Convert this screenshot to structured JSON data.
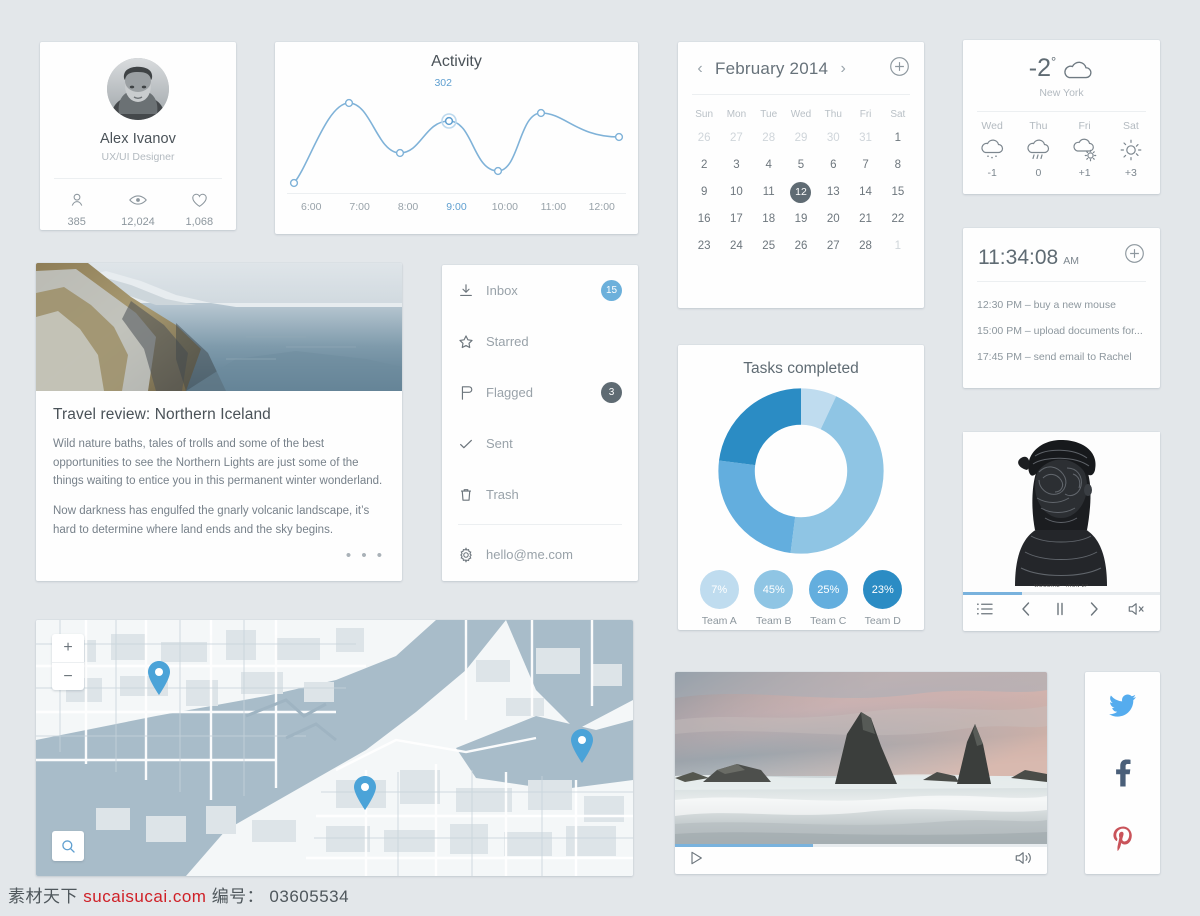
{
  "profile": {
    "name": "Alex Ivanov",
    "role": "UX/UI Designer",
    "stats": [
      {
        "icon": "person-icon",
        "value": "385"
      },
      {
        "icon": "eye-icon",
        "value": "12,024"
      },
      {
        "icon": "heart-icon",
        "value": "1,068"
      }
    ]
  },
  "activity": {
    "title": "Activity",
    "highlight_value": "302",
    "highlight_tick": "9:00"
  },
  "chart_data": [
    {
      "type": "line",
      "title": "Activity",
      "xlabel": "",
      "ylabel": "",
      "categories": [
        "6:00",
        "7:00",
        "8:00",
        "9:00",
        "10:00",
        "11:00",
        "12:00"
      ],
      "values": [
        20,
        330,
        175,
        302,
        110,
        320,
        205
      ],
      "highlight_index": 3,
      "highlight_label": "302",
      "grid": false,
      "legend": "none",
      "accent": "#6ba3d0"
    },
    {
      "type": "pie",
      "title": "Tasks completed",
      "categories": [
        "Team A",
        "Team B",
        "Team C",
        "Team D"
      ],
      "values": [
        7,
        45,
        25,
        23
      ],
      "labels": [
        "7%",
        "45%",
        "25%",
        "23%"
      ],
      "colors": [
        "#bfdcef",
        "#8fc5e4",
        "#63aede",
        "#2b8cc4"
      ],
      "donut": true,
      "legend": "bottom"
    }
  ],
  "calendar": {
    "month": "February 2014",
    "prev": "‹",
    "next": "›",
    "dow": [
      "Sun",
      "Mon",
      "Tue",
      "Wed",
      "Thu",
      "Fri",
      "Sat"
    ],
    "weeks": [
      [
        {
          "d": "26",
          "mute": true
        },
        {
          "d": "27",
          "mute": true
        },
        {
          "d": "28",
          "mute": true
        },
        {
          "d": "29",
          "mute": true
        },
        {
          "d": "30",
          "mute": true
        },
        {
          "d": "31",
          "mute": true
        },
        {
          "d": "1",
          "mute": false
        }
      ],
      [
        {
          "d": "2"
        },
        {
          "d": "3"
        },
        {
          "d": "4"
        },
        {
          "d": "5"
        },
        {
          "d": "6"
        },
        {
          "d": "7"
        },
        {
          "d": "8"
        }
      ],
      [
        {
          "d": "9"
        },
        {
          "d": "10"
        },
        {
          "d": "11"
        },
        {
          "d": "12",
          "sel": true
        },
        {
          "d": "13"
        },
        {
          "d": "14"
        },
        {
          "d": "15"
        }
      ],
      [
        {
          "d": "16"
        },
        {
          "d": "17"
        },
        {
          "d": "18"
        },
        {
          "d": "19"
        },
        {
          "d": "20"
        },
        {
          "d": "21"
        },
        {
          "d": "22"
        }
      ],
      [
        {
          "d": "23"
        },
        {
          "d": "24"
        },
        {
          "d": "25"
        },
        {
          "d": "26"
        },
        {
          "d": "27"
        },
        {
          "d": "28"
        },
        {
          "d": "1",
          "mute": true
        }
      ]
    ]
  },
  "weather": {
    "temp": "-2",
    "degree": "°",
    "now_icon": "cloud-icon",
    "city": "New York",
    "forecast": [
      {
        "day": "Wed",
        "icon": "snow-cloud-icon",
        "temp": "-1"
      },
      {
        "day": "Thu",
        "icon": "rain-cloud-icon",
        "temp": "0"
      },
      {
        "day": "Fri",
        "icon": "sun-cloud-icon",
        "temp": "+1"
      },
      {
        "day": "Sat",
        "icon": "sun-icon",
        "temp": "+3"
      }
    ]
  },
  "clock": {
    "time": "11:34:08",
    "ampm": "AM",
    "events": [
      "12:30 PM – buy a new mouse",
      "15:00  PM – upload documents for...",
      "17:45  PM – send email to Rachel"
    ]
  },
  "travel": {
    "title": "Travel review: Northern Iceland",
    "paragraph1": "Wild nature baths, tales of trolls and some of the best opportunities to see the Northern Lights are just some of the things waiting to entice you in this permanent winter wonderland.",
    "paragraph2": "Now darkness has engulfed the gnarly volcanic landscape, it’s hard to determine where land ends and the sky begins.",
    "more": "• • •"
  },
  "mail": {
    "items": [
      {
        "label": "Inbox",
        "icon": "inbox-icon",
        "badge": "15",
        "badge_color": "#6cb0db"
      },
      {
        "label": "Starred",
        "icon": "star-icon",
        "badge": "",
        "badge_color": ""
      },
      {
        "label": "Flagged",
        "icon": "flag-icon",
        "badge": "3",
        "badge_color": "#5f6b73"
      },
      {
        "label": "Sent",
        "icon": "check-icon",
        "badge": "",
        "badge_color": ""
      },
      {
        "label": "Trash",
        "icon": "trash-icon",
        "badge": "",
        "badge_color": ""
      }
    ],
    "account": {
      "label": "hello@me.com",
      "icon": "gear-icon"
    }
  },
  "music": {
    "caption": "WOODKID - IRON EP",
    "progress_pct": 30,
    "controls": [
      {
        "name": "playlist-icon"
      },
      {
        "name": "previous-icon"
      },
      {
        "name": "pause-icon"
      },
      {
        "name": "next-icon"
      },
      {
        "name": "volume-mute-icon"
      }
    ]
  },
  "video": {
    "progress_pct": 37,
    "play_icon": "play-icon",
    "volume_icon": "volume-icon"
  },
  "map": {
    "zoom_in": "+",
    "zoom_out": "−",
    "search_icon": "search-icon",
    "pins": 3
  },
  "social": [
    {
      "name": "twitter-icon",
      "color": "#55acee"
    },
    {
      "name": "facebook-icon",
      "color": "#4a5f79"
    },
    {
      "name": "pinterest-icon",
      "color": "#c9535a"
    }
  ],
  "watermark": {
    "prefix": "素材天下",
    "site": "sucaisucai.com",
    "label": "编号：",
    "code": "03605534"
  }
}
